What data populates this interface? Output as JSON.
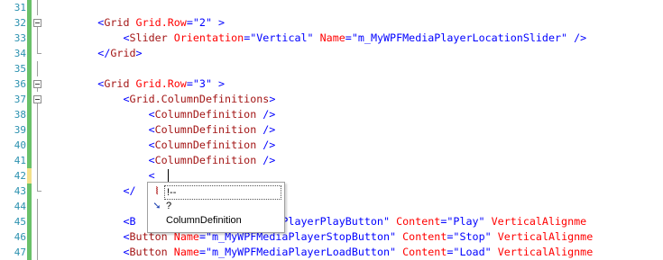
{
  "editor": {
    "lines": [
      {
        "num": "31",
        "outline": "line",
        "change": "saved",
        "tokens": []
      },
      {
        "num": "32",
        "outline": "box",
        "change": "saved",
        "tokens": [
          {
            "t": "        ",
            "c": "plain"
          },
          {
            "t": "<",
            "c": "blue"
          },
          {
            "t": "Grid",
            "c": "el"
          },
          {
            "t": " ",
            "c": "plain"
          },
          {
            "t": "Grid.Row",
            "c": "attr"
          },
          {
            "t": "=\"2\"",
            "c": "blue"
          },
          {
            "t": " >",
            "c": "blue"
          }
        ]
      },
      {
        "num": "33",
        "outline": "line",
        "change": "saved",
        "tokens": [
          {
            "t": "            ",
            "c": "plain"
          },
          {
            "t": "<",
            "c": "blue"
          },
          {
            "t": "Slider",
            "c": "el"
          },
          {
            "t": " ",
            "c": "plain"
          },
          {
            "t": "Orientation",
            "c": "attr"
          },
          {
            "t": "=\"Vertical\"",
            "c": "blue"
          },
          {
            "t": " ",
            "c": "plain"
          },
          {
            "t": "Name",
            "c": "attr"
          },
          {
            "t": "=\"m_MyWPFMediaPlayerLocationSlider\"",
            "c": "blue"
          },
          {
            "t": " />",
            "c": "blue"
          }
        ]
      },
      {
        "num": "34",
        "outline": "end",
        "change": "saved",
        "tokens": [
          {
            "t": "        ",
            "c": "plain"
          },
          {
            "t": "</",
            "c": "blue"
          },
          {
            "t": "Grid",
            "c": "el"
          },
          {
            "t": ">",
            "c": "blue"
          }
        ]
      },
      {
        "num": "35",
        "outline": "line",
        "change": "saved",
        "tokens": []
      },
      {
        "num": "36",
        "outline": "box",
        "change": "saved",
        "tokens": [
          {
            "t": "        ",
            "c": "plain"
          },
          {
            "t": "<",
            "c": "blue"
          },
          {
            "t": "Grid",
            "c": "el"
          },
          {
            "t": " ",
            "c": "plain"
          },
          {
            "t": "Grid.Row",
            "c": "attr"
          },
          {
            "t": "=\"3\"",
            "c": "blue"
          },
          {
            "t": " >",
            "c": "blue"
          }
        ]
      },
      {
        "num": "37",
        "outline": "box",
        "change": "saved",
        "tokens": [
          {
            "t": "            ",
            "c": "plain"
          },
          {
            "t": "<",
            "c": "blue"
          },
          {
            "t": "Grid.ColumnDefinitions",
            "c": "el"
          },
          {
            "t": ">",
            "c": "blue"
          }
        ]
      },
      {
        "num": "38",
        "outline": "line",
        "change": "saved",
        "tokens": [
          {
            "t": "                ",
            "c": "plain"
          },
          {
            "t": "<",
            "c": "blue"
          },
          {
            "t": "ColumnDefinition",
            "c": "el"
          },
          {
            "t": " />",
            "c": "blue"
          }
        ]
      },
      {
        "num": "39",
        "outline": "line",
        "change": "saved",
        "tokens": [
          {
            "t": "                ",
            "c": "plain"
          },
          {
            "t": "<",
            "c": "blue"
          },
          {
            "t": "ColumnDefinition",
            "c": "el"
          },
          {
            "t": " />",
            "c": "blue"
          }
        ]
      },
      {
        "num": "40",
        "outline": "line",
        "change": "saved",
        "tokens": [
          {
            "t": "                ",
            "c": "plain"
          },
          {
            "t": "<",
            "c": "blue"
          },
          {
            "t": "ColumnDefinition",
            "c": "el"
          },
          {
            "t": " />",
            "c": "blue"
          }
        ]
      },
      {
        "num": "41",
        "outline": "line",
        "change": "saved",
        "tokens": [
          {
            "t": "                ",
            "c": "plain"
          },
          {
            "t": "<",
            "c": "blue"
          },
          {
            "t": "ColumnDefinition",
            "c": "el"
          },
          {
            "t": " />",
            "c": "blue"
          }
        ]
      },
      {
        "num": "42",
        "outline": "line",
        "change": "unsaved",
        "tokens": [
          {
            "t": "                ",
            "c": "plain"
          },
          {
            "t": "<",
            "c": "blue"
          }
        ]
      },
      {
        "num": "43",
        "outline": "end",
        "change": "saved",
        "tokens": [
          {
            "t": "            ",
            "c": "plain"
          },
          {
            "t": "</",
            "c": "blue"
          },
          {
            "t": "            ",
            "c": "plain"
          },
          {
            "t": "itions",
            "c": "el"
          },
          {
            "t": ">",
            "c": "blue"
          }
        ]
      },
      {
        "num": "44",
        "outline": "line",
        "change": "saved",
        "tokens": []
      },
      {
        "num": "45",
        "outline": "line",
        "change": "saved",
        "tokens": [
          {
            "t": "            ",
            "c": "plain"
          },
          {
            "t": "<B",
            "c": "blue"
          },
          {
            "t": "               ",
            "c": "plain"
          },
          {
            "t": "WPFMediaPlayerPlayButton\"",
            "c": "blue"
          },
          {
            "t": " ",
            "c": "plain"
          },
          {
            "t": "Content",
            "c": "attr"
          },
          {
            "t": "=\"Play\"",
            "c": "blue"
          },
          {
            "t": " ",
            "c": "plain"
          },
          {
            "t": "VerticalAlignme",
            "c": "attr"
          }
        ]
      },
      {
        "num": "46",
        "outline": "line",
        "change": "saved",
        "tokens": [
          {
            "t": "            ",
            "c": "plain"
          },
          {
            "t": "<",
            "c": "blue"
          },
          {
            "t": "Button",
            "c": "el"
          },
          {
            "t": " ",
            "c": "plain"
          },
          {
            "t": "Name",
            "c": "attr"
          },
          {
            "t": "=\"m_MyWPFMediaPlayerStopButton\"",
            "c": "blue"
          },
          {
            "t": " ",
            "c": "plain"
          },
          {
            "t": "Content",
            "c": "attr"
          },
          {
            "t": "=\"Stop\"",
            "c": "blue"
          },
          {
            "t": " ",
            "c": "plain"
          },
          {
            "t": "VerticalAlignme",
            "c": "attr"
          }
        ]
      },
      {
        "num": "47",
        "outline": "line",
        "change": "saved",
        "tokens": [
          {
            "t": "            ",
            "c": "plain"
          },
          {
            "t": "<",
            "c": "blue"
          },
          {
            "t": "Button",
            "c": "el"
          },
          {
            "t": " ",
            "c": "plain"
          },
          {
            "t": "Name",
            "c": "attr"
          },
          {
            "t": "=\"m_MyWPFMediaPlayerLoadButton\"",
            "c": "blue"
          },
          {
            "t": " ",
            "c": "plain"
          },
          {
            "t": "Content",
            "c": "attr"
          },
          {
            "t": "=\"Load\"",
            "c": "blue"
          },
          {
            "t": " ",
            "c": "plain"
          },
          {
            "t": "VerticalAlignme",
            "c": "attr"
          }
        ]
      }
    ]
  },
  "completion": {
    "items": [
      {
        "label": "!--",
        "icon": "comment-icon",
        "glyph": "⦚",
        "selected": true
      },
      {
        "label": "?",
        "icon": "processing-instruction-icon",
        "glyph": "➘",
        "selected": false
      },
      {
        "label": "ColumnDefinition",
        "icon": "element-icon",
        "glyph": "",
        "selected": false
      }
    ]
  },
  "colors": {
    "keyword": "#0000ff",
    "element": "#a31515",
    "attribute": "#ff0000",
    "line_number": "#2b91af",
    "change_saved": "#6ac06a",
    "change_unsaved": "#f3e08a"
  }
}
